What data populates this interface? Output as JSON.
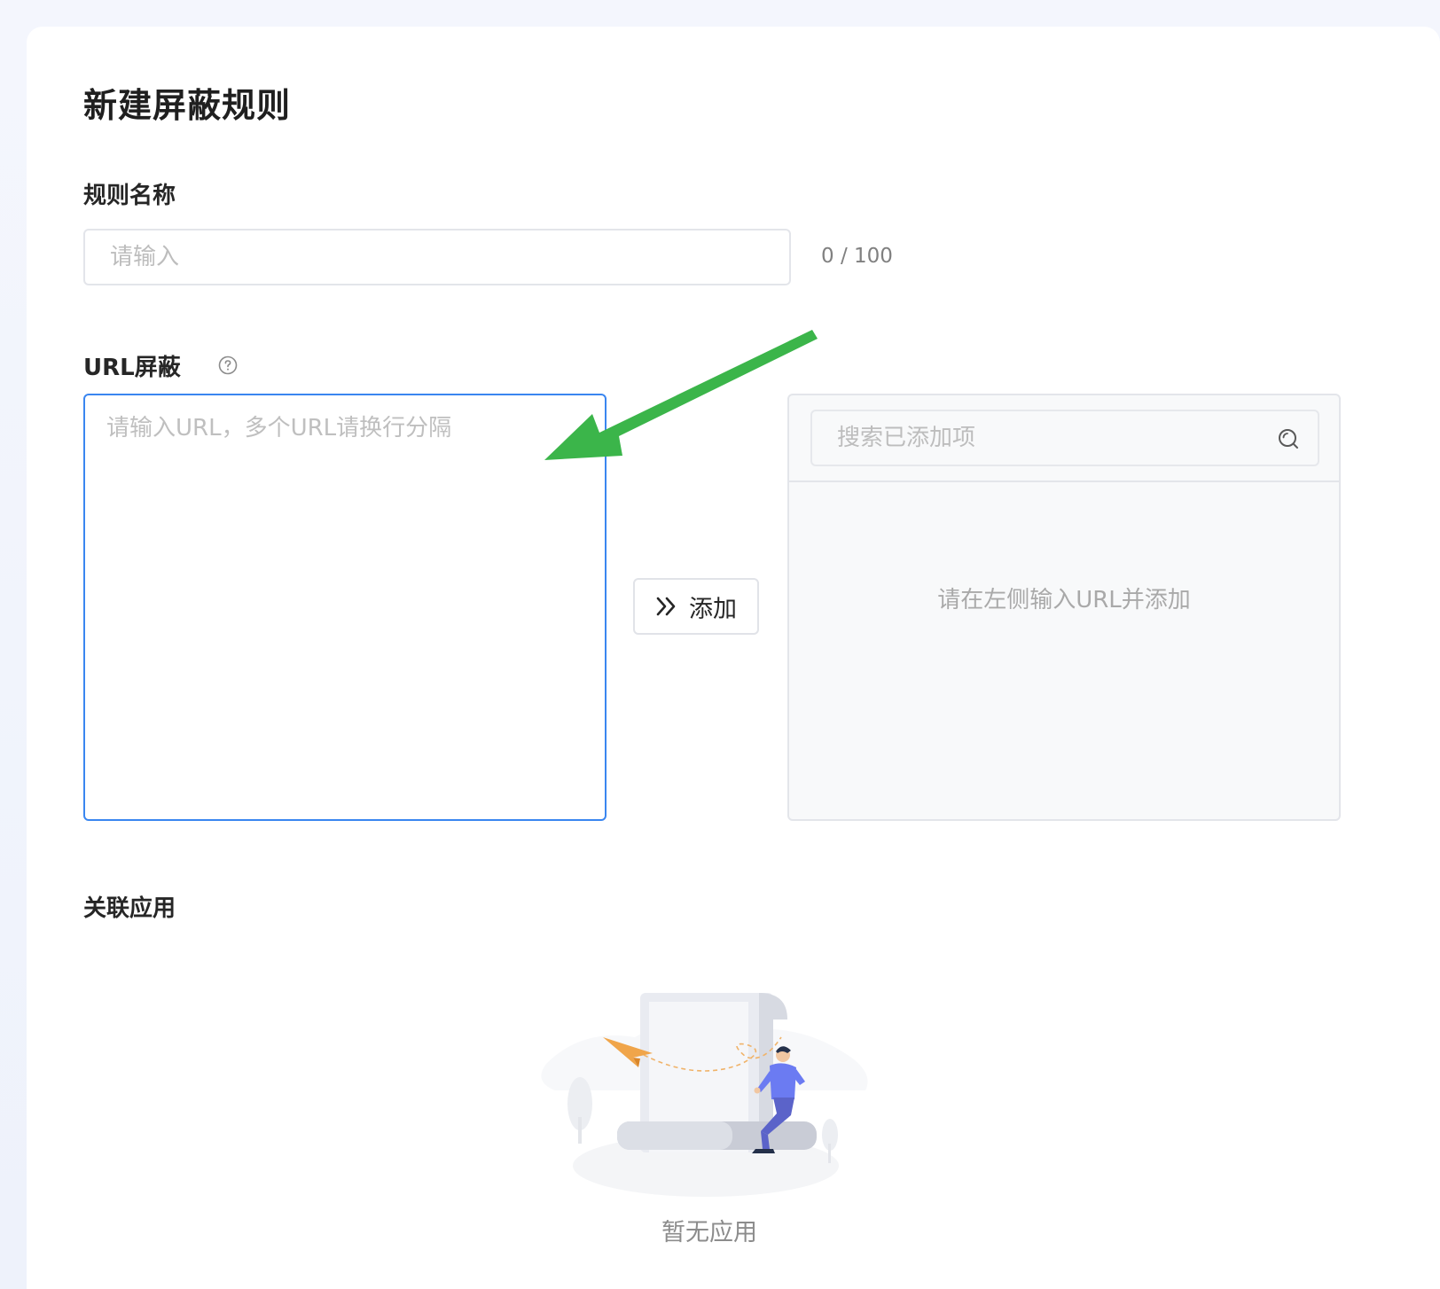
{
  "page": {
    "title": "新建屏蔽规则"
  },
  "rule_name": {
    "label": "规则名称",
    "placeholder": "请输入",
    "value": "",
    "counter": "0 / 100"
  },
  "url_block": {
    "label": "URL屏蔽",
    "help_icon": "question-circle-icon",
    "textarea_placeholder": "请输入URL，多个URL请换行分隔",
    "textarea_value": "",
    "add_button_label": "添加",
    "add_button_icon": "double-chevron-right-icon",
    "search_placeholder": "搜索已添加项",
    "search_icon": "search-icon",
    "empty_hint": "请在左侧输入URL并添加"
  },
  "related_apps": {
    "label": "关联应用",
    "empty_text": "暂无应用"
  },
  "colors": {
    "focus_border": "#3a86f0",
    "annotation_arrow": "#3bb54a",
    "illustration_accent": "#6b7bf2",
    "paper_plane": "#f0a54a"
  }
}
